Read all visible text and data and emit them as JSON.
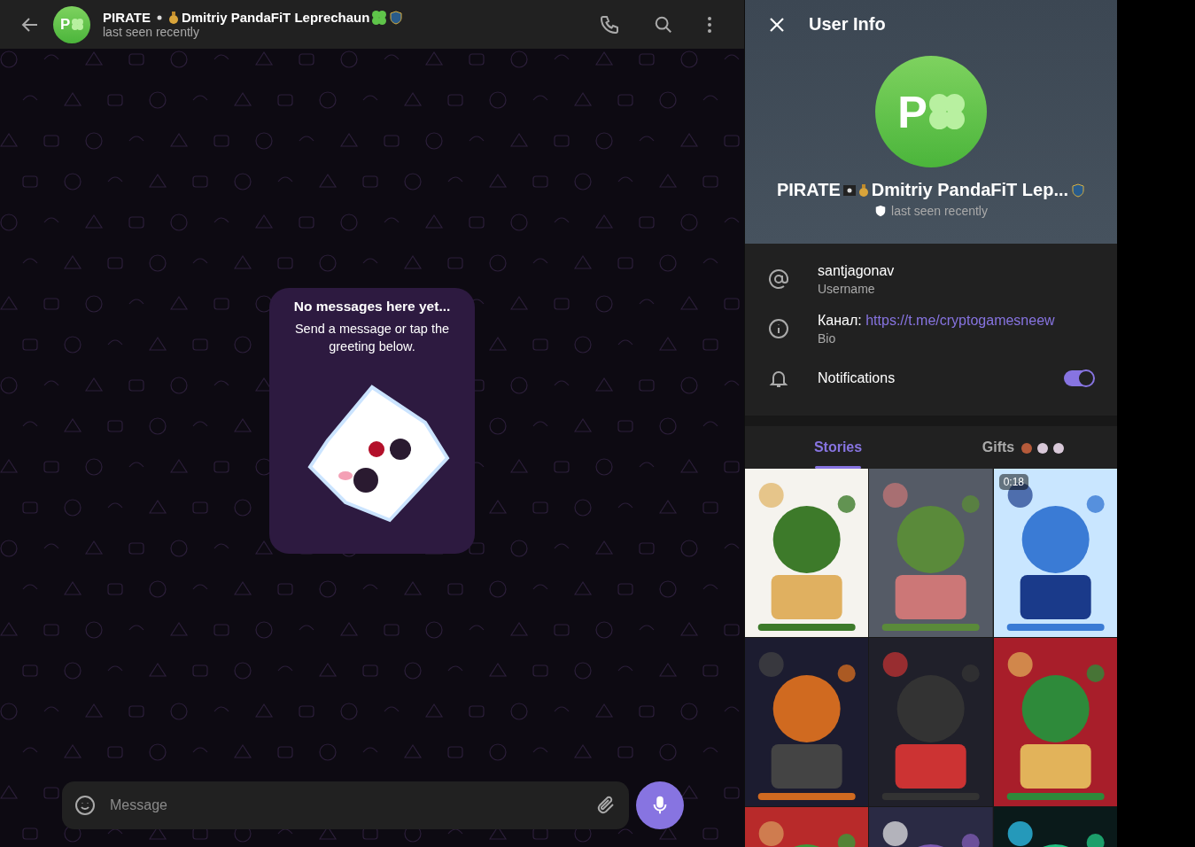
{
  "chat_header": {
    "avatar_initial": "P",
    "title_start": "PIRATE",
    "title_end": "Dmitriy PandaFiT Leprechaun",
    "status": "last seen recently"
  },
  "empty_state": {
    "title": "No messages here yet...",
    "text": "Send a message or tap the greeting below."
  },
  "composer": {
    "placeholder": "Message"
  },
  "user_info": {
    "title": "User Info",
    "avatar_initial": "P",
    "name_start": "PIRATE",
    "name_end": "Dmitriy PandaFiT Lep...",
    "status": "last seen recently",
    "rows": [
      {
        "kind": "username",
        "value": "santjagonav",
        "label": "Username"
      },
      {
        "kind": "bio",
        "prefix": "Канал:",
        "link": "https://t.me/cryptogamesneew",
        "label": "Bio"
      },
      {
        "kind": "notifications",
        "value": "Notifications",
        "on": true
      }
    ],
    "tabs": [
      {
        "label": "Stories",
        "selected": true
      },
      {
        "label": "Gifts",
        "selected": false
      }
    ],
    "stories": [
      {
        "kind": "picture"
      },
      {
        "kind": "picture"
      },
      {
        "kind": "picture",
        "duration": "0:18"
      },
      {
        "kind": "picture"
      },
      {
        "kind": "picture"
      },
      {
        "kind": "picture"
      },
      {
        "kind": "picture"
      },
      {
        "kind": "picture"
      },
      {
        "kind": "picture"
      }
    ]
  }
}
